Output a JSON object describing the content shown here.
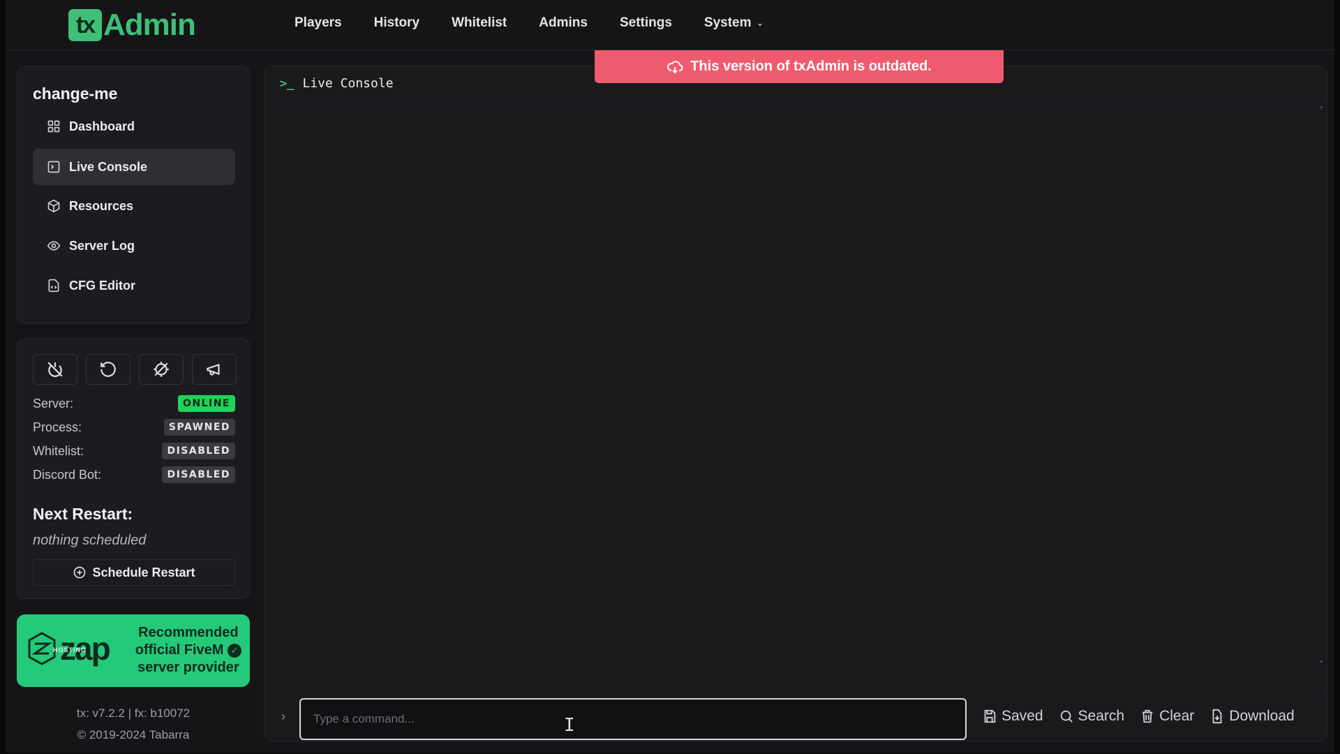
{
  "header": {
    "logo_tx": "tx",
    "logo_admin": "Admin",
    "nav": [
      {
        "label": "Players"
      },
      {
        "label": "History"
      },
      {
        "label": "Whitelist"
      },
      {
        "label": "Admins"
      },
      {
        "label": "Settings"
      },
      {
        "label": "System"
      }
    ]
  },
  "alert": {
    "text": "This version of txAdmin is outdated.",
    "color": "#ef5b6e"
  },
  "sidebar": {
    "server_name": "change-me",
    "items": [
      {
        "label": "Dashboard",
        "icon": "grid-icon"
      },
      {
        "label": "Live Console",
        "icon": "terminal-square-icon",
        "active": true
      },
      {
        "label": "Resources",
        "icon": "package-icon"
      },
      {
        "label": "Server Log",
        "icon": "eye-icon"
      },
      {
        "label": "CFG Editor",
        "icon": "file-code-icon"
      }
    ]
  },
  "controls": {
    "buttons": [
      "power-off-icon",
      "restart-icon",
      "scan-off-icon",
      "megaphone-icon"
    ],
    "status": [
      {
        "label": "Server:",
        "value": "ONLINE"
      },
      {
        "label": "Process:",
        "value": "SPAWNED"
      },
      {
        "label": "Whitelist:",
        "value": "DISABLED"
      },
      {
        "label": "Discord Bot:",
        "value": "DISABLED"
      }
    ],
    "next_restart_title": "Next Restart:",
    "next_restart_value": "nothing scheduled",
    "schedule_button": "Schedule Restart"
  },
  "zap": {
    "brand": "zap",
    "sub": "HOSTING",
    "line1": "Recommended",
    "line2": "official FiveM",
    "line3": "server provider",
    "color": "#24c97a"
  },
  "version": {
    "line1": "tx: v7.2.2 | fx: b10072",
    "line2": "© 2019-2024 Tabarra"
  },
  "console": {
    "title": "Live Console",
    "prompt_symbol": "›",
    "input_placeholder": "Type a command...",
    "actions": [
      {
        "label": "Saved",
        "icon": "save-icon"
      },
      {
        "label": "Search",
        "icon": "search-icon"
      },
      {
        "label": "Clear",
        "icon": "trash-icon"
      },
      {
        "label": "Download",
        "icon": "download-file-icon"
      }
    ]
  },
  "colors": {
    "accent": "#3fbf78",
    "online": "#1fd35a"
  }
}
